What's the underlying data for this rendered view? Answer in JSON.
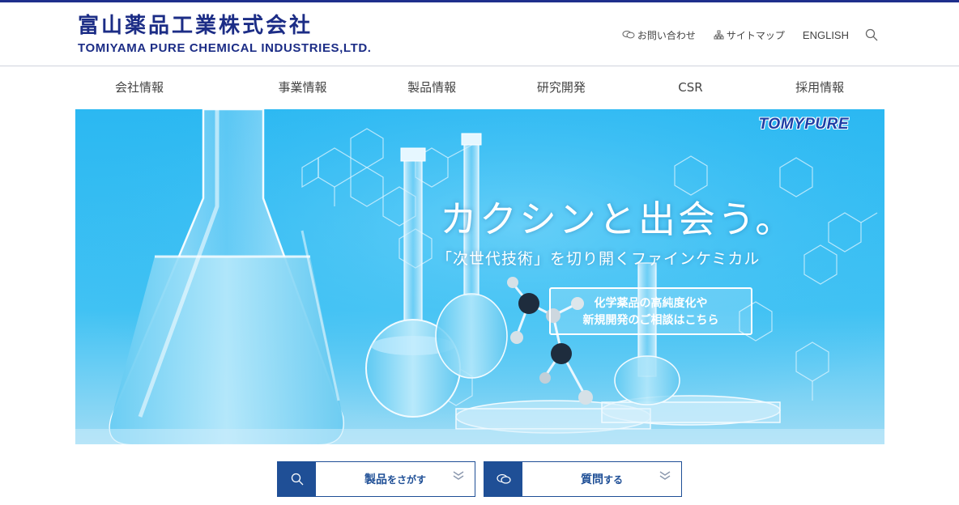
{
  "logo": {
    "name_jp": "富山薬品工業株式会社",
    "name_en": "TOMIYAMA PURE CHEMICAL INDUSTRIES,LTD."
  },
  "utility_nav": {
    "contact": "お問い合わせ",
    "sitemap": "サイトマップ",
    "english": "ENGLISH"
  },
  "global_nav": [
    "会社情報",
    "事業情報",
    "製品情報",
    "研究開発",
    "CSR",
    "採用情報"
  ],
  "hero": {
    "brand": "TOMYPURE",
    "title": "カクシンと出会う。",
    "subtitle": "「次世代技術」を切り開くファインケミカル",
    "cta_line1": "化学薬品の高純度化や",
    "cta_line2": "新規開発のご相談はこちら"
  },
  "bottom_buttons": [
    {
      "strong": "製品",
      "small": "をさがす",
      "icon": "search-icon"
    },
    {
      "strong": "質問",
      "small": "する",
      "icon": "chat-icon"
    }
  ],
  "colors": {
    "brand_navy": "#1c2d86",
    "button_blue": "#1f4f96",
    "hero_blue": "#29b4ee"
  }
}
